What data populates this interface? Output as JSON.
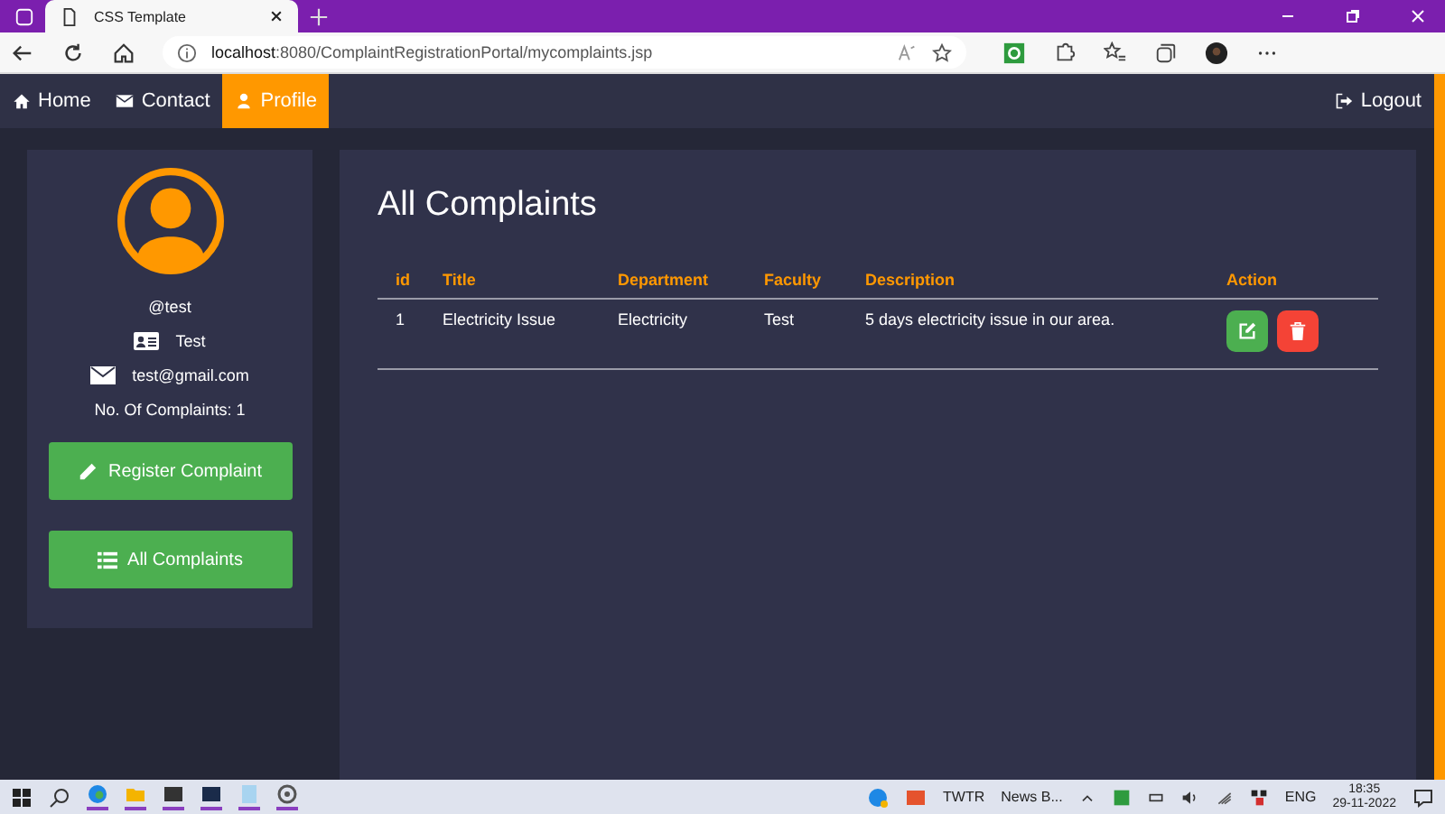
{
  "browser": {
    "tab_title": "CSS Template",
    "url": "**localhost**:8080/ComplaintRegistrationPortal/mycomplaints.jsp"
  },
  "nav": {
    "items": [
      {
        "label": "Home",
        "selected": false
      },
      {
        "label": "Contact",
        "selected": false
      },
      {
        "label": "Profile",
        "selected": true
      }
    ],
    "logout": "Logout"
  },
  "profile": {
    "username": "@test",
    "name": "Test",
    "email": "test@gmail.com",
    "complaints": "No. Of Complaints: 1"
  },
  "sidebar_buttons": [
    {
      "label": "Register Complaint"
    },
    {
      "label": "All Complaints"
    }
  ],
  "main": {
    "title": "All Complaints",
    "table": {
      "columns": [
        "id",
        "Title",
        "Department",
        "Faculty",
        "Description",
        "Action"
      ],
      "rows": [
        {
          "cells": [
            "1",
            "Electricity Issue",
            "Electricity",
            "Test",
            "5 days electricity issue in our area."
          ]
        }
      ]
    }
  },
  "taskbar": {
    "tray": [
      "TWTR",
      "News B...",
      "ENG"
    ],
    "time": "18:35",
    "date": "29-11-2022"
  }
}
